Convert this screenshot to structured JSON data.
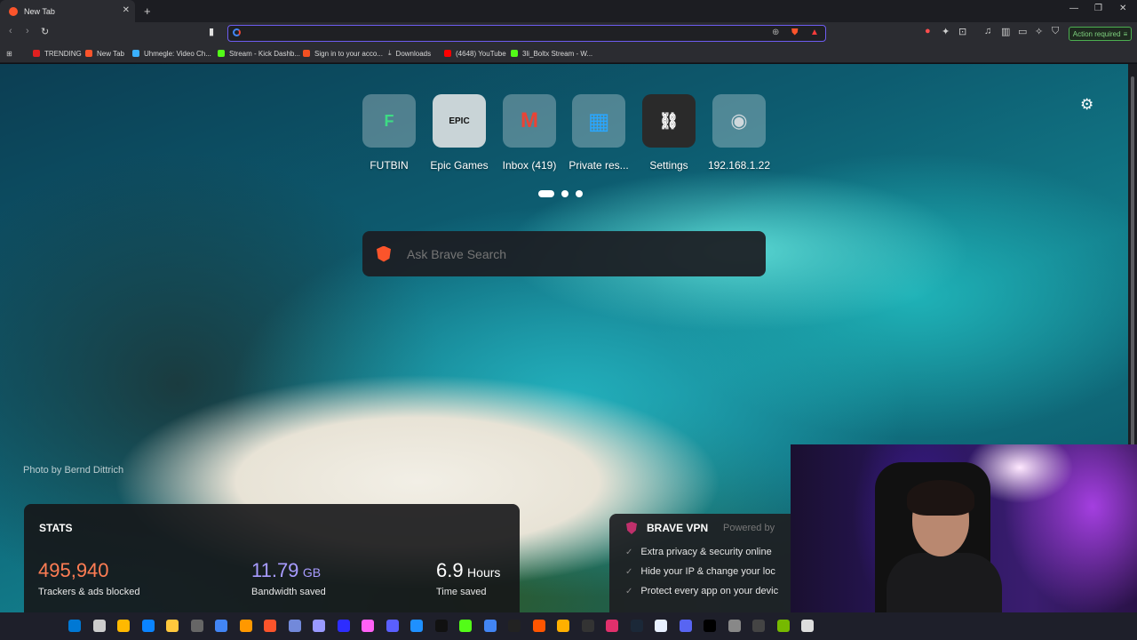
{
  "browser": {
    "tab_title": "New Tab",
    "new_tab_symbol": "+",
    "close_symbol": "✕",
    "window_controls": [
      "—",
      "❐",
      "✕"
    ],
    "address_value": "",
    "action_required": "Action required",
    "accent_color": "#6d5cf0"
  },
  "bookmarks": [
    {
      "label": "TRENDING",
      "color": "#e02020"
    },
    {
      "label": "New Tab",
      "color": "#fb542b"
    },
    {
      "label": "Uhmegle: Video Ch...",
      "color": "#3ab0ff"
    },
    {
      "label": "Stream - Kick Dashb...",
      "color": "#53fc18"
    },
    {
      "label": "Sign in to your acco...",
      "color": "#f25022"
    },
    {
      "label": "Downloads",
      "color": "#cccccc"
    },
    {
      "label": "(4648) YouTube",
      "color": "#ff0000"
    },
    {
      "label": "3li_Boltx Stream - W...",
      "color": "#53fc18"
    }
  ],
  "tiles": [
    {
      "label": "FUTBIN",
      "icon": "futbin-icon",
      "glyph": "F",
      "color": "#3ddc84"
    },
    {
      "label": "Epic Games",
      "icon": "epic-games-icon",
      "glyph": "EPIC",
      "color": "#111111"
    },
    {
      "label": "Inbox (419)",
      "icon": "gmail-icon",
      "glyph": "M",
      "color": "#ea4335"
    },
    {
      "label": "Private res...",
      "icon": "private-icon",
      "glyph": "▦",
      "color": "#2aa7ff"
    },
    {
      "label": "Settings",
      "icon": "link-icon",
      "glyph": "⛓",
      "color": "#ffffff"
    },
    {
      "label": "192.168.1.22",
      "icon": "globe-icon",
      "glyph": "◉",
      "color": "#cfd8dc"
    }
  ],
  "search": {
    "placeholder": "Ask Brave Search"
  },
  "photo_credit": "Photo by Bernd Dittrich",
  "stats": {
    "heading": "STATS",
    "items": [
      {
        "value": "495,940",
        "unit": "",
        "desc": "Trackers & ads blocked",
        "color": "#ff7d54"
      },
      {
        "value": "11.79",
        "unit": "GB",
        "desc": "Bandwidth saved",
        "color": "#a89cff"
      },
      {
        "value": "6.9",
        "unit": "Hours",
        "desc": "Time saved",
        "color": "#ffffff"
      }
    ]
  },
  "vpn": {
    "title": "BRAVE VPN",
    "powered": "Powered by",
    "items": [
      "Extra privacy & security online",
      "Hide your IP & change your loc",
      "Protect every app on your devic"
    ]
  },
  "taskbar_colors": [
    "#0078d4",
    "#cccccc",
    "#ffb900",
    "#0a84ff",
    "#ffc83d",
    "#666666",
    "#4285f4",
    "#ff9800",
    "#fb542b",
    "#7289da",
    "#9999ff",
    "#2d2dff",
    "#ff61f6",
    "#5a5fff",
    "#1f90ff",
    "#111111",
    "#53fc18",
    "#4285f4",
    "#222222",
    "#ff5500",
    "#ffb000",
    "#333333",
    "#e1306c",
    "#1b2838",
    "#e8f0ff",
    "#5865f2",
    "#000000",
    "#888888",
    "#444444",
    "#76b900",
    "#dddddd"
  ]
}
